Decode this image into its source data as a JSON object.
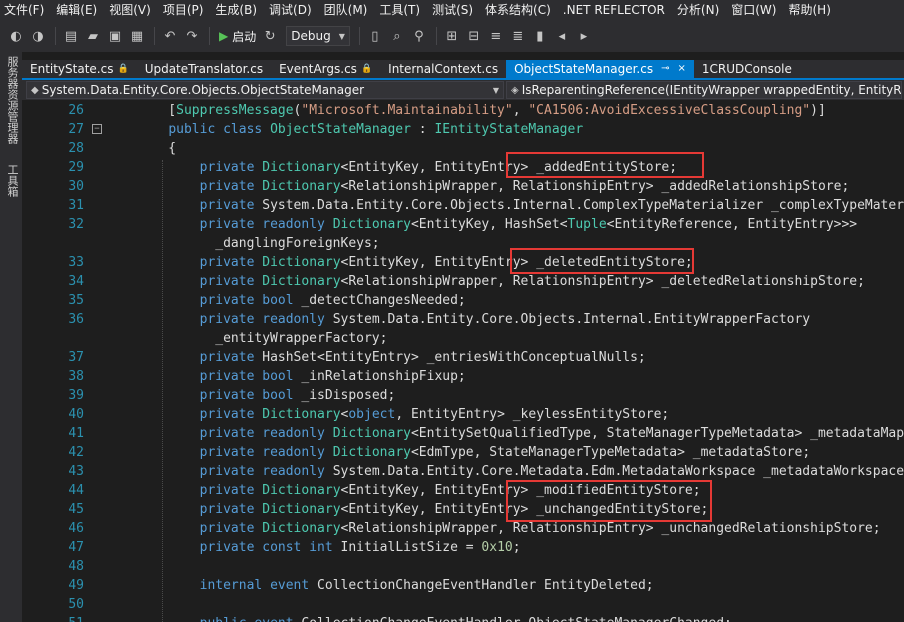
{
  "menu": [
    "文件(F)",
    "编辑(E)",
    "视图(V)",
    "项目(P)",
    "生成(B)",
    "调试(D)",
    "团队(M)",
    "工具(T)",
    "测试(S)",
    "体系结构(C)",
    ".NET REFLECTOR",
    "分析(N)",
    "窗口(W)",
    "帮助(H)"
  ],
  "toolbar": {
    "start_label": "启动",
    "config": "Debug"
  },
  "side_tabs": [
    "服务器资源管理器",
    "工具箱"
  ],
  "tabs": [
    {
      "label": "EntityState.cs",
      "locked": true
    },
    {
      "label": "UpdateTranslator.cs",
      "locked": false
    },
    {
      "label": "EventArgs.cs",
      "locked": true
    },
    {
      "label": "InternalContext.cs",
      "locked": false
    },
    {
      "label": "ObjectStateManager.cs",
      "locked": false,
      "active": true
    },
    {
      "label": "1CRUDConsole",
      "locked": false
    }
  ],
  "tab_glyphs": {
    "pin": "⊸",
    "close": "×",
    "lock": "🔒"
  },
  "nav": {
    "type": "System.Data.Entity.Core.Objects.ObjectStateManager",
    "member": "IsReparentingReference(IEntityWrapper wrappedEntity, EntityRef"
  },
  "code_lines": [
    {
      "n": "26",
      "html": "    [<span class=\"ty\">SuppressMessage</span>(<span class=\"st\">\"Microsoft.Maintainability\"</span>, <span class=\"st\">\"CA1506:AvoidExcessiveClassCoupling\"</span>)]"
    },
    {
      "n": "27",
      "fold": true,
      "html": "    <span class=\"kw\">public</span> <span class=\"kw\">class</span> <span class=\"ty\">ObjectStateManager</span> : <span class=\"ty\">IEntityStateManager</span>"
    },
    {
      "n": "28",
      "html": "    {"
    },
    {
      "n": "29",
      "html": "        <span class=\"kw\">private</span> <span class=\"ty\">Dictionary</span>&lt;EntityKey, EntityEntry&gt; _addedEntityStore;"
    },
    {
      "n": "30",
      "html": "        <span class=\"kw\">private</span> <span class=\"ty\">Dictionary</span>&lt;RelationshipWrapper, RelationshipEntry&gt; _addedRelationshipStore;"
    },
    {
      "n": "31",
      "html": "        <span class=\"kw\">private</span> System.Data.Entity.Core.Objects.Internal.ComplexTypeMaterializer _complexTypeMateria"
    },
    {
      "n": "32",
      "html": "        <span class=\"kw\">private</span> <span class=\"kw\">readonly</span> <span class=\"ty\">Dictionary</span>&lt;EntityKey, HashSet&lt;<span class=\"ty\">Tuple</span>&lt;EntityReference, EntityEntry&gt;&gt;&gt;"
    },
    {
      "n": "",
      "html": "          _danglingForeignKeys;"
    },
    {
      "n": "33",
      "html": "        <span class=\"kw\">private</span> <span class=\"ty\">Dictionary</span>&lt;EntityKey, EntityEntry&gt; _deletedEntityStore;"
    },
    {
      "n": "34",
      "html": "        <span class=\"kw\">private</span> <span class=\"ty\">Dictionary</span>&lt;RelationshipWrapper, RelationshipEntry&gt; _deletedRelationshipStore;"
    },
    {
      "n": "35",
      "html": "        <span class=\"kw\">private</span> <span class=\"kw\">bool</span> _detectChangesNeeded;"
    },
    {
      "n": "36",
      "html": "        <span class=\"kw\">private</span> <span class=\"kw\">readonly</span> System.Data.Entity.Core.Objects.Internal.EntityWrapperFactory"
    },
    {
      "n": "",
      "html": "          _entityWrapperFactory;"
    },
    {
      "n": "37",
      "html": "        <span class=\"kw\">private</span> HashSet&lt;EntityEntry&gt; _entriesWithConceptualNulls;"
    },
    {
      "n": "38",
      "html": "        <span class=\"kw\">private</span> <span class=\"kw\">bool</span> _inRelationshipFixup;"
    },
    {
      "n": "39",
      "html": "        <span class=\"kw\">private</span> <span class=\"kw\">bool</span> _isDisposed;"
    },
    {
      "n": "40",
      "html": "        <span class=\"kw\">private</span> <span class=\"ty\">Dictionary</span>&lt;<span class=\"kw\">object</span>, EntityEntry&gt; _keylessEntityStore;"
    },
    {
      "n": "41",
      "html": "        <span class=\"kw\">private</span> <span class=\"kw\">readonly</span> <span class=\"ty\">Dictionary</span>&lt;EntitySetQualifiedType, StateManagerTypeMetadata&gt; _metadataMappi"
    },
    {
      "n": "42",
      "html": "        <span class=\"kw\">private</span> <span class=\"kw\">readonly</span> <span class=\"ty\">Dictionary</span>&lt;EdmType, StateManagerTypeMetadata&gt; _metadataStore;"
    },
    {
      "n": "43",
      "html": "        <span class=\"kw\">private</span> <span class=\"kw\">readonly</span> System.Data.Entity.Core.Metadata.Edm.MetadataWorkspace _metadataWorkspace;"
    },
    {
      "n": "44",
      "html": "        <span class=\"kw\">private</span> <span class=\"ty\">Dictionary</span>&lt;EntityKey, EntityEntry&gt; _modifiedEntityStore;"
    },
    {
      "n": "45",
      "html": "        <span class=\"kw\">private</span> <span class=\"ty\">Dictionary</span>&lt;EntityKey, EntityEntry&gt; _unchangedEntityStore;"
    },
    {
      "n": "46",
      "html": "        <span class=\"kw\">private</span> <span class=\"ty\">Dictionary</span>&lt;RelationshipWrapper, RelationshipEntry&gt; _unchangedRelationshipStore;"
    },
    {
      "n": "47",
      "html": "        <span class=\"kw\">private</span> <span class=\"kw\">const</span> <span class=\"kw\">int</span> InitialListSize = <span class=\"nm\">0x10</span>;"
    },
    {
      "n": "48",
      "html": ""
    },
    {
      "n": "49",
      "html": "        <span class=\"kw\">internal</span> <span class=\"kw\">event</span> CollectionChangeEventHandler EntityDeleted;"
    },
    {
      "n": "50",
      "html": ""
    },
    {
      "n": "51",
      "html": "        <span class=\"kw\">public</span> <span class=\"kw\">event</span> CollectionChangeEventHandler ObjectStateManagerChanged;"
    }
  ],
  "highlight_color": "#e53935"
}
